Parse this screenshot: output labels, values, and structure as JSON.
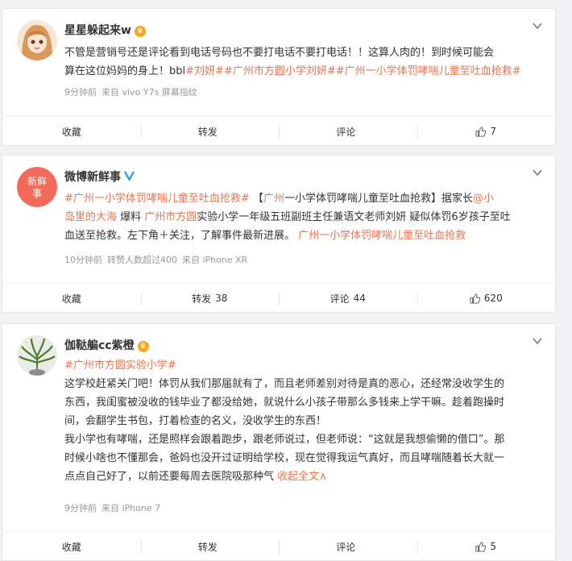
{
  "posts": [
    {
      "username": "星星躲起来w",
      "lines": [
        [
          {
            "t": "不管是营销号还是评论看到电话号码也不要打电话不要打电话！！这算人肉的！到时候可能会",
            "c": "plain"
          }
        ],
        [
          {
            "t": "算在这位妈妈的身上！bbl",
            "c": "plain"
          },
          {
            "t": "#刘妍#",
            "c": "tag"
          },
          {
            "t": "#广州市方圆小学刘妍#",
            "c": "tag"
          },
          {
            "t": "#广州一小学体罚哮喘儿童至吐血抢救#",
            "c": "tag"
          }
        ]
      ],
      "meta": [
        "9分钟前",
        "来自 vivo Y7s 屏幕指纹"
      ],
      "actions": {
        "collect": "收藏",
        "repost": "转发",
        "repost_count": "",
        "comment": "评论",
        "comment_count": "",
        "like_count": "7"
      }
    },
    {
      "username": "微博新鲜事",
      "lines": [
        [
          {
            "t": "#广州一小学体罚哮喘儿童至吐血抢救#",
            "c": "tag"
          },
          {
            "t": " 【",
            "c": "plain"
          },
          {
            "t": "广州",
            "c": "tag"
          },
          {
            "t": "一小学体罚哮喘儿童至吐血抢救】据家长",
            "c": "plain"
          },
          {
            "t": "@小",
            "c": "tag"
          }
        ],
        [
          {
            "t": "岛里的大海",
            "c": "tag"
          },
          {
            "t": " 爆料 ",
            "c": "plain"
          },
          {
            "t": "广州市方圆",
            "c": "tag"
          },
          {
            "t": "实验小学一年级五班副班主任兼语文老师刘妍 疑似体罚6岁孩子至吐",
            "c": "plain"
          }
        ],
        [
          {
            "t": "血送至抢救。左下角＋关注，了解事件最新进展。 ",
            "c": "plain"
          },
          {
            "t": "广州一小学体罚哮喘儿童至吐血抢救",
            "c": "tag"
          }
        ]
      ],
      "meta": [
        "10分钟前",
        "转赞人数超过400",
        "来自 iPhone XR"
      ],
      "actions": {
        "collect": "收藏",
        "repost": "转发",
        "repost_count": "38",
        "comment": "评论",
        "comment_count": "44",
        "like_count": "620"
      }
    },
    {
      "username": "伽鞑艑cc紫橙",
      "lines": [
        [
          {
            "t": "#广州市方圆",
            "c": "tag"
          },
          {
            "t": "实验小学#",
            "c": "tag"
          }
        ],
        [
          {
            "t": "这学校赶紧关门吧！体罚从我们那届就有了，而且老师差别对待是真的恶心，还经常没收学生的",
            "c": "plain"
          }
        ],
        [
          {
            "t": "东西，我闺蜜被没收的钱毕业了都没给她，就说什么小孩子带那么多钱来上学干嘛。趁着跑操时",
            "c": "plain"
          }
        ],
        [
          {
            "t": "间，会翻学生书包，打着检查的名义，没收学生的东西！",
            "c": "plain"
          }
        ],
        [
          {
            "t": "我小学也有哮喘，还是照样会跟着跑步，跟老师说过，但老师说：“这就是我想偷懒的借口”。那",
            "c": "plain"
          }
        ],
        [
          {
            "t": "时候小啥也不懂那会，爸妈也没开过证明给学校，现在觉得我运气真好，而且哮喘随着长大就一",
            "c": "plain"
          }
        ],
        [
          {
            "t": "点点自己好了，以前还要每周去医院吸那种气 ",
            "c": "plain"
          },
          {
            "t": "收起全文∧",
            "c": "tag"
          }
        ]
      ],
      "meta": [
        "9分钟前",
        "来自 iPhone 7"
      ],
      "actions": {
        "collect": "收藏",
        "repost": "转发",
        "repost_count": "",
        "comment": "评论",
        "comment_count": "",
        "like_count": "5"
      }
    }
  ],
  "icons": {
    "more": "chevron-down-icon",
    "like": "thumb-up-icon",
    "vip": "vip-crown-icon",
    "verified": "verified-icon"
  },
  "colors": {
    "link": "#eb7350",
    "text": "#333333",
    "meta": "#999999",
    "background": "#f2f2f5"
  }
}
